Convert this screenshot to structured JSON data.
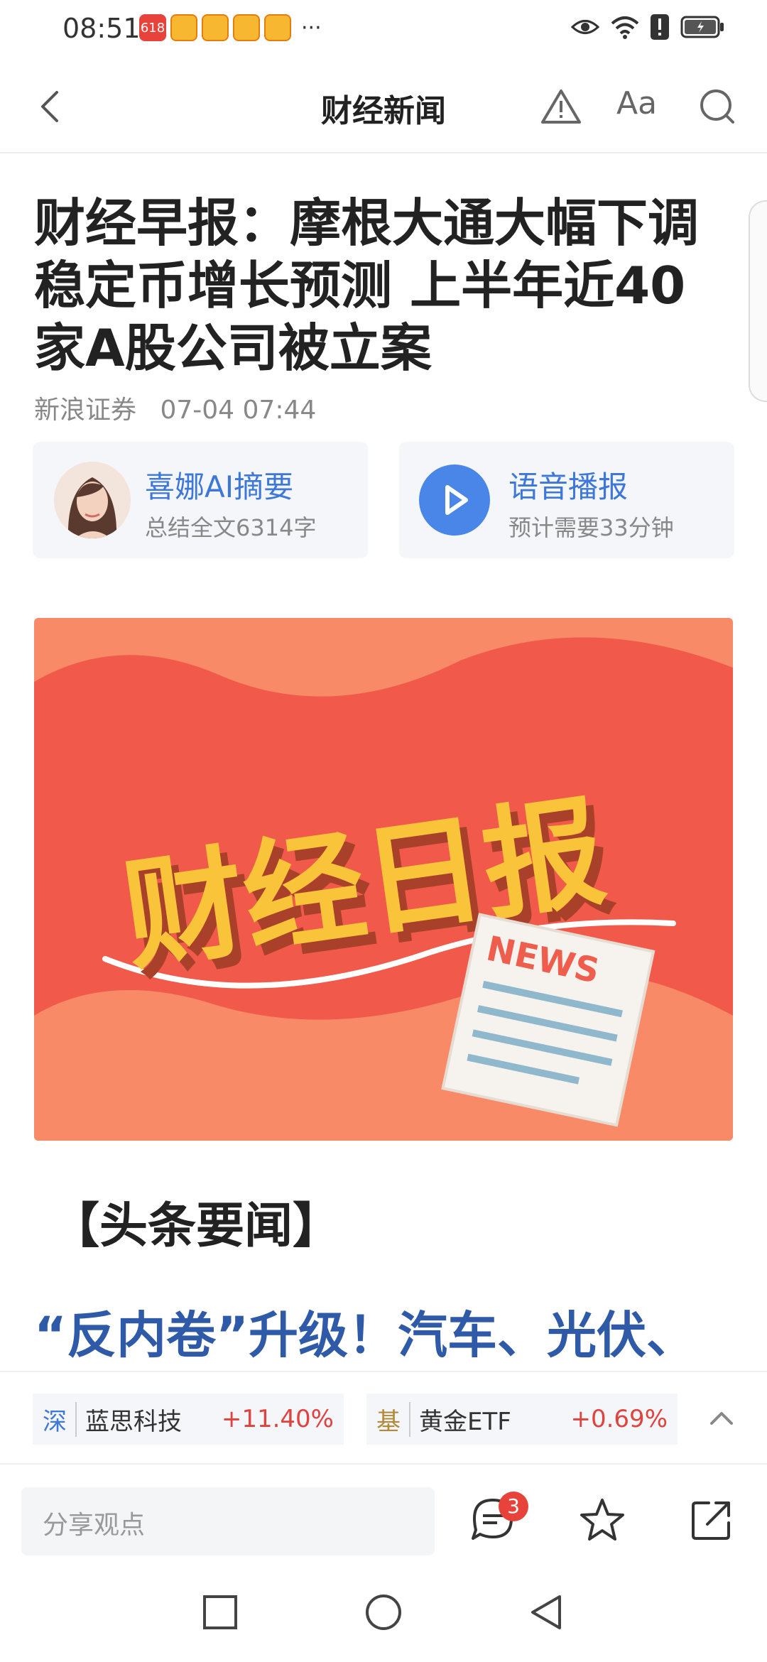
{
  "status_bar": {
    "time": "08:51",
    "notifications": [
      "pinduoduo-icon",
      "weibo-icon",
      "weibo-icon",
      "weibo-icon",
      "weibo-icon"
    ],
    "more": "···",
    "icons": [
      "eye-icon",
      "wifi-icon",
      "alert-icon",
      "battery-icon"
    ]
  },
  "nav": {
    "title": "财经新闻",
    "font_label": "Aa"
  },
  "article": {
    "headline": "财经早报：摩根大通大幅下调稳定币增长预测 上半年近40家A股公司被立案",
    "source": "新浪证券",
    "datetime": "07-04 07:44"
  },
  "ai_summary": {
    "title": "喜娜AI摘要",
    "subtitle": "总结全文6314字"
  },
  "audio": {
    "title": "语音播报",
    "subtitle": "预计需要33分钟"
  },
  "banner": {
    "main_text": "财经日报",
    "paper_text": "NEWS"
  },
  "section": {
    "title": "【头条要闻】",
    "pull_quote": "“反内卷”升级！汽车、光伏、"
  },
  "tickers": [
    {
      "market": "深",
      "name": "蓝思科技",
      "change": "+11.40%"
    },
    {
      "market": "基",
      "name": "黄金ETF",
      "change": "+0.69%"
    }
  ],
  "action_bar": {
    "comment_placeholder": "分享观点",
    "comment_count": "3"
  },
  "colors": {
    "accent_blue": "#3d78d8",
    "rise_red": "#e0423d",
    "banner_red": "#f15a4a",
    "banner_yellow": "#f9c43a"
  }
}
